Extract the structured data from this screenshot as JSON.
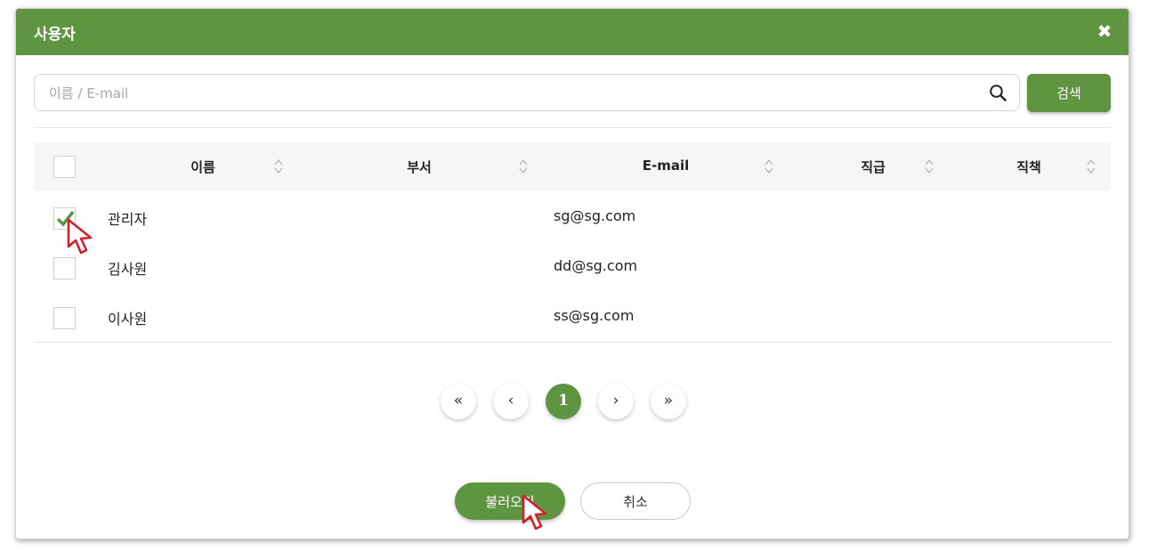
{
  "dialog": {
    "title": "사용자",
    "close_icon": "close-icon",
    "accent_color": "#5f9440"
  },
  "search": {
    "placeholder": "이름 / E-mail",
    "value": "",
    "button_label": "검색",
    "icon": "search-icon"
  },
  "table": {
    "columns": [
      "이름",
      "부서",
      "E-mail",
      "직급",
      "직책"
    ],
    "header_checkbox_checked": false,
    "rows": [
      {
        "checked": true,
        "name": "관리자",
        "department": "",
        "email": "sg@sg.com",
        "rank": "",
        "position": ""
      },
      {
        "checked": false,
        "name": "김사원",
        "department": "",
        "email": "dd@sg.com",
        "rank": "",
        "position": ""
      },
      {
        "checked": false,
        "name": "이사원",
        "department": "",
        "email": "ss@sg.com",
        "rank": "",
        "position": ""
      }
    ]
  },
  "pagination": {
    "first": "«",
    "prev": "‹",
    "current": "1",
    "next": "›",
    "last": "»"
  },
  "footer": {
    "confirm_label": "불러오기",
    "cancel_label": "취소"
  }
}
